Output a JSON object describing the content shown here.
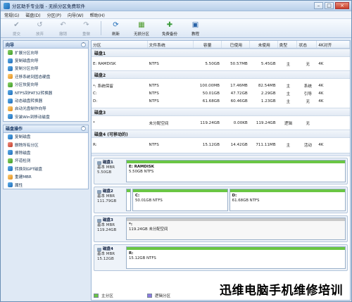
{
  "window": {
    "title": "分区助手专业版 - 无损分区免费软件"
  },
  "menu": [
    "常规(G)",
    "磁盘(D)",
    "分区(P)",
    "向导(W)",
    "帮助(H)"
  ],
  "toolbar": [
    {
      "label": "提交",
      "icon": "commit-icon",
      "enabled": false
    },
    {
      "label": "放弃",
      "icon": "discard-icon",
      "enabled": false
    },
    {
      "label": "撤销",
      "icon": "undo-icon",
      "enabled": false
    },
    {
      "label": "重做",
      "icon": "redo-icon",
      "enabled": false
    },
    {
      "label": "刷新",
      "icon": "refresh-icon",
      "enabled": true
    },
    {
      "label": "无损分区",
      "icon": "lossless-partition-icon",
      "enabled": true
    },
    {
      "label": "免费备份",
      "icon": "free-backup-icon",
      "enabled": true
    },
    {
      "label": "教程",
      "icon": "tutorial-icon",
      "enabled": true
    }
  ],
  "wizard_panel": {
    "title": "向导",
    "items": [
      "扩展分区向导",
      "复制磁盘向导",
      "复制分区向导",
      "迁移系统到固态硬盘",
      "分区恢复向导",
      "NTFS到FAT32转换器",
      "动态磁盘转换器",
      "启动光盘制作向导",
      "安装Win到移动磁盘"
    ]
  },
  "disk_ops_panel": {
    "title": "磁盘操作",
    "items": [
      "复制磁盘",
      "删除所有分区",
      "擦除磁盘",
      "坏道检测",
      "转换到GPT磁盘",
      "重建MBR",
      "属性"
    ]
  },
  "table": {
    "headers": [
      "分区",
      "文件系统",
      "容量",
      "已使用",
      "未使用",
      "类型",
      "状态",
      "4K对齐"
    ],
    "disks": [
      {
        "name": "磁盘1",
        "rows": [
          [
            "E: RAMDISK",
            "NTFS",
            "5.50GB",
            "50.57MB",
            "5.45GB",
            "主",
            "无",
            "4K"
          ]
        ]
      },
      {
        "name": "磁盘2",
        "rows": [
          [
            "*: 系统保留",
            "NTFS",
            "100.00MB",
            "17.46MB",
            "82.54MB",
            "主",
            "系统",
            "4K"
          ],
          [
            "C:",
            "NTFS",
            "50.01GB",
            "47.72GB",
            "2.29GB",
            "主",
            "引导",
            "4K"
          ],
          [
            "D:",
            "NTFS",
            "61.68GB",
            "60.46GB",
            "1.23GB",
            "主",
            "无",
            "4K"
          ]
        ]
      },
      {
        "name": "磁盘3",
        "rows": [
          [
            "*",
            "未分配空间",
            "119.24GB",
            "0.00KB",
            "119.24GB",
            "逻辑",
            "无",
            ""
          ]
        ]
      },
      {
        "name": "磁盘4 (可移动的)",
        "rows": [
          [
            "R:",
            "NTFS",
            "15.12GB",
            "14.42GB",
            "711.11MB",
            "主",
            "活动",
            "4K"
          ]
        ]
      }
    ]
  },
  "diskmap": [
    {
      "name": "磁盘1",
      "type": "基本 MBR",
      "size": "5.50GB",
      "parts": [
        {
          "name": "E: RAMDISK",
          "info": "5.50GB NTFS",
          "kind": "primary",
          "share": 1.0
        }
      ]
    },
    {
      "name": "磁盘2",
      "type": "基本 MBR",
      "size": "111.79GB",
      "parts": [
        {
          "name": "",
          "info": "",
          "kind": "primary",
          "share": 0.02
        },
        {
          "name": "C:",
          "info": "50.01GB NTFS",
          "kind": "primary",
          "share": 0.44
        },
        {
          "name": "D:",
          "info": "61.68GB NTFS",
          "kind": "primary",
          "share": 0.54
        }
      ]
    },
    {
      "name": "磁盘3",
      "type": "基本 MBR",
      "size": "119.24GB",
      "parts": [
        {
          "name": "*:",
          "info": "119.24GB 未分配空间",
          "kind": "unallocated",
          "share": 1.0
        }
      ]
    },
    {
      "name": "磁盘4",
      "type": "基本 MBR",
      "size": "15.12GB",
      "parts": [
        {
          "name": "R:",
          "info": "15.12GB NTFS",
          "kind": "primary",
          "share": 1.0
        }
      ]
    }
  ],
  "legend": {
    "primary": "主分区",
    "logical": "逻辑分区"
  },
  "watermark": "迅维电脑手机维修培训",
  "colors": {
    "primary_bar": "#6ac644",
    "logical_bar": "#8c7ae0",
    "unallocated_bar": "#c9c9c9",
    "accent": "#1e6cb8"
  }
}
